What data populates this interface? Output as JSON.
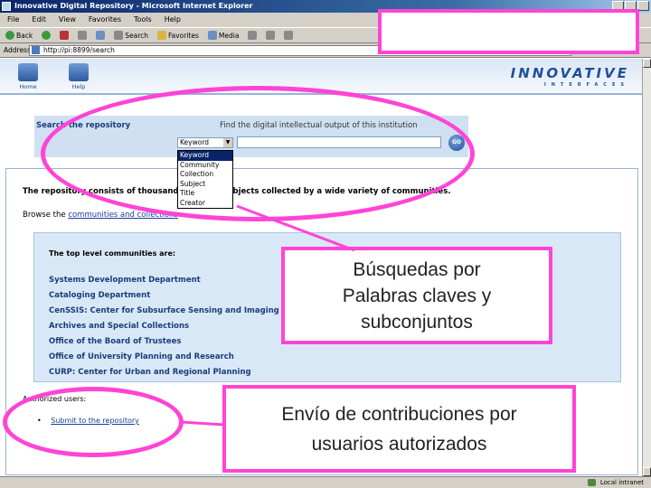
{
  "window": {
    "title": "Innovative Digital Repository - Microsoft Internet Explorer"
  },
  "menu": [
    "File",
    "Edit",
    "View",
    "Favorites",
    "Tools",
    "Help"
  ],
  "toolbar": {
    "back": "Back",
    "search": "Search",
    "favorites": "Favorites",
    "media": "Media"
  },
  "address": {
    "label": "Address",
    "url": "http://pi:8899/search"
  },
  "site": {
    "home_label": "Home",
    "help_label": "Help",
    "logo": "INNOVATIVE",
    "logo_sub": "INTERFACES"
  },
  "search": {
    "title": "Search the repository",
    "hint": "Find the digital intellectual output of this institution",
    "selected": "Keyword",
    "options": [
      "Keyword",
      "Community",
      "Collection",
      "Subject",
      "Title",
      "Creator"
    ],
    "go": "GO"
  },
  "content": {
    "intro": "The repository consists of thousands of digital objects collected by a wide variety of communities.",
    "browse_prefix": "Browse the",
    "browse_link": "communities and collections",
    "communities_header": "The top level communities are:",
    "communities": [
      "Systems Development Department",
      "Cataloging Department",
      "CenSSIS: Center for Subsurface Sensing and Imaging Systems",
      "Archives and Special Collections",
      "Office of the Board of Trustees",
      "Office of University Planning and Research",
      "CURP: Center for Urban and Regional Planning"
    ],
    "authorized_label": "Authorized users:",
    "bullet": "•",
    "submit_link": "Submit to the repository"
  },
  "status": {
    "zone": "Local intranet"
  },
  "annotations": {
    "callout1": [
      "Búsquedas por",
      "Palabras claves y",
      "subconjuntos"
    ],
    "callout2": [
      "Envío de contribuciones por",
      "usuarios autorizados"
    ],
    "accent_color": "#ff44d6"
  }
}
